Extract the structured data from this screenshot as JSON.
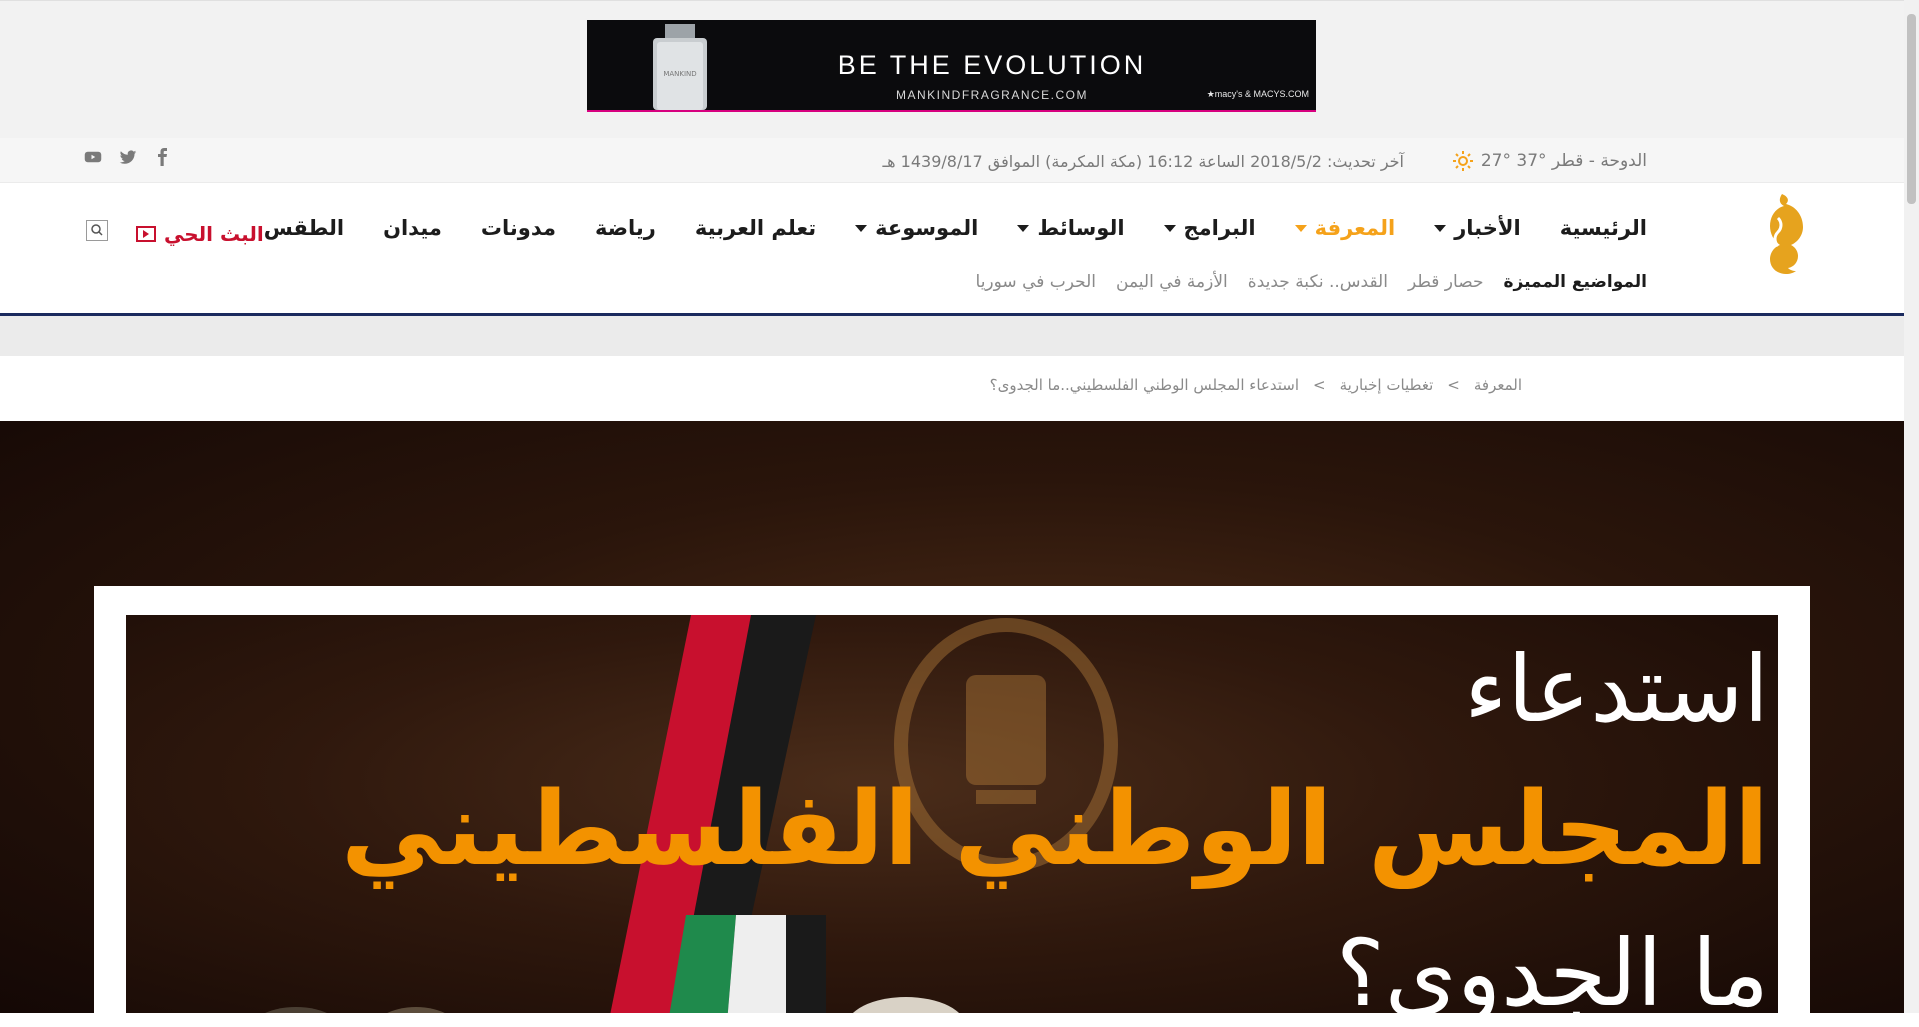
{
  "ad": {
    "headline": "BE THE EVOLUTION",
    "url": "MANKINDFRAGRANCE.COM",
    "sponsor": "★macy's & MACYS.COM",
    "bottle_label": "MANKIND"
  },
  "infobar": {
    "weather": "الدوحة - قطر °37 °27",
    "updated": "آخر تحديث: 2018/5/2 الساعة 16:12 (مكة المكرمة) الموافق 1439/8/17 هـ",
    "social": [
      "facebook-icon",
      "twitter-icon",
      "youtube-icon"
    ]
  },
  "nav": {
    "items": [
      {
        "label": "الرئيسية",
        "dropdown": false
      },
      {
        "label": "الأخبار",
        "dropdown": true
      },
      {
        "label": "المعرفة",
        "dropdown": true,
        "active": true
      },
      {
        "label": "البرامج",
        "dropdown": true
      },
      {
        "label": "الوسائط",
        "dropdown": true
      },
      {
        "label": "الموسوعة",
        "dropdown": true
      },
      {
        "label": "تعلم العربية",
        "dropdown": false
      },
      {
        "label": "رياضة",
        "dropdown": false
      },
      {
        "label": "مدونات",
        "dropdown": false
      },
      {
        "label": "ميدان",
        "dropdown": false
      },
      {
        "label": "الطقس",
        "dropdown": false
      }
    ],
    "live": "البث الحي",
    "accent": "#f5a21a",
    "live_color": "#c8102e"
  },
  "featured": {
    "title": "المواضيع المميزة",
    "links": [
      "حصار قطر",
      "القدس.. نكبة جديدة",
      "الأزمة في اليمن",
      "الحرب في سوريا"
    ]
  },
  "breadcrumb": {
    "items": [
      "المعرفة",
      "تغطيات إخبارية",
      "استدعاء المجلس الوطني الفلسطيني..ما الجدوى؟"
    ],
    "separator": ">"
  },
  "hero": {
    "line1": "استدعاء",
    "line2": "المجلس الوطني الفلسطيني",
    "line3": "ما الجدوى؟",
    "highlight_color": "#f39200"
  }
}
